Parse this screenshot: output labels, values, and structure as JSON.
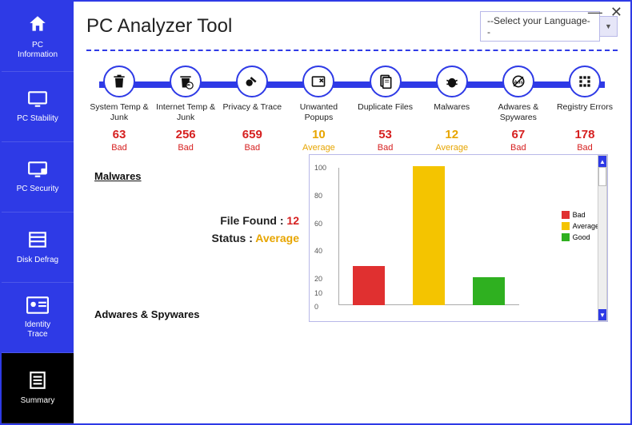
{
  "header": {
    "title": "PC Analyzer Tool",
    "language_placeholder": "--Select your Language--"
  },
  "window_controls": {
    "minimize": "—",
    "close": "✕"
  },
  "sidebar": {
    "items": [
      {
        "label": "PC\nInformation"
      },
      {
        "label": "PC Stability"
      },
      {
        "label": "PC Security"
      },
      {
        "label": "Disk Defrag"
      },
      {
        "label": "Identity\nTrace"
      },
      {
        "label": "Summary"
      }
    ]
  },
  "scan": {
    "items": [
      {
        "label": "System Temp & Junk",
        "count": 63,
        "status": "Bad",
        "cls": "c-bad"
      },
      {
        "label": "Internet Temp & Junk",
        "count": 256,
        "status": "Bad",
        "cls": "c-bad"
      },
      {
        "label": "Privacy & Trace",
        "count": 659,
        "status": "Bad",
        "cls": "c-bad"
      },
      {
        "label": "Unwanted Popups",
        "count": 10,
        "status": "Average",
        "cls": "c-avg"
      },
      {
        "label": "Duplicate Files",
        "count": 53,
        "status": "Bad",
        "cls": "c-bad"
      },
      {
        "label": "Malwares",
        "count": 12,
        "status": "Average",
        "cls": "c-avg"
      },
      {
        "label": "Adwares & Spywares",
        "count": 67,
        "status": "Bad",
        "cls": "c-bad"
      },
      {
        "label": "Registry Errors",
        "count": 178,
        "status": "Bad",
        "cls": "c-bad"
      }
    ]
  },
  "detail": {
    "section_title": "Malwares",
    "file_found_label": "File Found : ",
    "file_found_value": "12",
    "status_label": "Status : ",
    "status_value": "Average",
    "next_section": "Adwares & Spywares"
  },
  "legend": {
    "bad": "Bad",
    "avg": "Average",
    "good": "Good"
  },
  "colors": {
    "bad": "#e03030",
    "avg": "#f4c400",
    "good": "#2fb020",
    "brand": "#2e3ae6"
  },
  "chart_data": {
    "type": "bar",
    "categories": [
      "Bad",
      "Average",
      "Good"
    ],
    "values": [
      28,
      100,
      20
    ],
    "ylim": [
      0,
      100
    ],
    "yticks": [
      0,
      10,
      20,
      40,
      60,
      80,
      100
    ],
    "title": "",
    "xlabel": "",
    "ylabel": ""
  }
}
